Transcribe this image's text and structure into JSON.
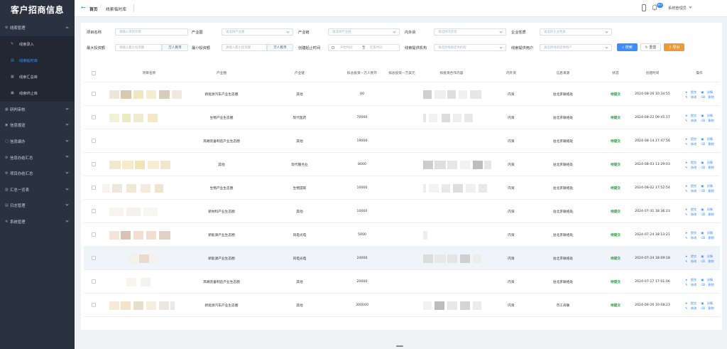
{
  "app": {
    "title": "客户招商信息"
  },
  "sidebar": {
    "groups": [
      {
        "label": "线索管理",
        "icon": "gear-icon",
        "expanded": true,
        "children": [
          {
            "label": "线索录入",
            "icon": "edit-icon",
            "active": false
          },
          {
            "label": "线索临时库",
            "icon": "folder-icon",
            "active": true
          },
          {
            "label": "线索汇总库",
            "icon": "database-icon",
            "active": false
          },
          {
            "label": "线索终止库",
            "icon": "archive-icon",
            "active": false
          }
        ]
      },
      {
        "label": "研判审核",
        "icon": "grid-icon"
      },
      {
        "label": "信息报送",
        "icon": "user-icon"
      },
      {
        "label": "信息编办",
        "icon": "document-icon"
      },
      {
        "label": "信息办结汇总",
        "icon": "gear-icon"
      },
      {
        "label": "项目办结汇总",
        "icon": "gear-icon"
      },
      {
        "label": "汇总一览表",
        "icon": "chart-icon"
      },
      {
        "label": "日志管理",
        "icon": "log-icon"
      },
      {
        "label": "系统管理",
        "icon": "settings-icon"
      }
    ]
  },
  "header": {
    "back_icon": "arrow-left-icon",
    "home": "首页",
    "separator": "/",
    "current": "线索临时库",
    "notification_count": "99+",
    "user": "系统管理员"
  },
  "filters": {
    "project_name": {
      "label": "项目名称",
      "placeholder": "请输入项目名称"
    },
    "industry_circle": {
      "label": "产业圈",
      "placeholder": "请选择产业圈"
    },
    "industry_chain": {
      "label": "产业链",
      "placeholder": "请选择产业链"
    },
    "domestic": {
      "label": "内外资",
      "placeholder": "请选择内外资"
    },
    "enterprise_type": {
      "label": "企业性质",
      "placeholder": "请选择企业性质"
    },
    "max_invest": {
      "label": "最大投资额",
      "placeholder": "请输入最大投资额",
      "unit": "万人民币"
    },
    "min_invest": {
      "label": "最小投资额",
      "placeholder": "请输入最小投资额",
      "unit": "万人民币"
    },
    "create_time": {
      "label": "创建起止时间",
      "start": "开始时间",
      "to": "至",
      "end": "结束时间"
    },
    "provider_org": {
      "label": "线索提供机构",
      "placeholder": "请选择线索提供机构"
    },
    "provider_user": {
      "label": "线索提供用户",
      "placeholder": "请选择线索提供用户"
    },
    "search": "搜索",
    "reset": "重置",
    "export": "导出"
  },
  "table": {
    "columns": [
      "项目名称",
      "产业圈",
      "产业链",
      "拟总投资—万人民币",
      "拟总投资—万美元",
      "拟投资合作内容",
      "内外资",
      "信息来源",
      "状态",
      "创建时间",
      "操作"
    ],
    "actions": {
      "submit": "提交",
      "detail": "详情",
      "edit": "修改",
      "delete": "删除"
    },
    "rows": [
      {
        "circle": "新能源汽车产业生态圈",
        "chain": "其他",
        "rmb": "00",
        "domestic": "内资",
        "source": "驻北京联络处",
        "status": "待提交",
        "time": "2024-08-26 10:34:55"
      },
      {
        "circle": "生物产业生态圈",
        "chain": "现代医药",
        "rmb": "70000",
        "domestic": "内资",
        "source": "驻北京联络处",
        "status": "待提交",
        "time": "2024-08-22 09:45:17"
      },
      {
        "circle": "高端装备制造产业生态圈",
        "chain": "其他",
        "rmb": "19000",
        "domestic": "内资",
        "source": "驻北京联络处",
        "status": "待提交",
        "time": "2024-08-14 17:47:56"
      },
      {
        "circle": "其他",
        "chain": "现代服务业",
        "rmb": "8000",
        "domestic": "内资",
        "source": "驻北京联络处",
        "status": "待提交",
        "time": "2024-08-03 11:29:03"
      },
      {
        "circle": "生物产业生态圈",
        "chain": "生物提取",
        "rmb": "10000",
        "domestic": "内资",
        "source": "驻北京联络处",
        "status": "待提交",
        "time": "2024-08-02 17:52:54"
      },
      {
        "circle": "新材料产业生态圈",
        "chain": "其他",
        "rmb": "10000",
        "domestic": "内资",
        "source": "驻北京联络处",
        "status": "待提交",
        "time": "2024-07-31 18:36:23"
      },
      {
        "circle": "新能源产业生态圈",
        "chain": "风电光电",
        "rmb": "5000",
        "domestic": "内资",
        "source": "驻北京联络处",
        "status": "待提交",
        "time": "2024-07-24 18:13:21"
      },
      {
        "circle": "新能源产业生态圈",
        "chain": "风电光电",
        "rmb": "24000",
        "domestic": "内资",
        "source": "驻北京联络处",
        "status": "待提交",
        "time": "2024-07-24 18:09:18"
      },
      {
        "circle": "高端装备制造产业生态圈",
        "chain": "其他",
        "rmb": "20000",
        "domestic": "内资",
        "source": "驻北京联络处",
        "status": "待提交",
        "time": "2024-07-17 17:01:06"
      },
      {
        "circle": "新能源汽车产业生态圈",
        "chain": "其他",
        "rmb": "300000",
        "domestic": "内资",
        "source": "市工商联",
        "status": "待提交",
        "time": "2024-06-26 10:08:23"
      }
    ]
  },
  "colors": {
    "accent": "#3b8cff",
    "status": "#1f9d3a",
    "export": "#ec9b3b",
    "sidebar": "#2a3240"
  }
}
